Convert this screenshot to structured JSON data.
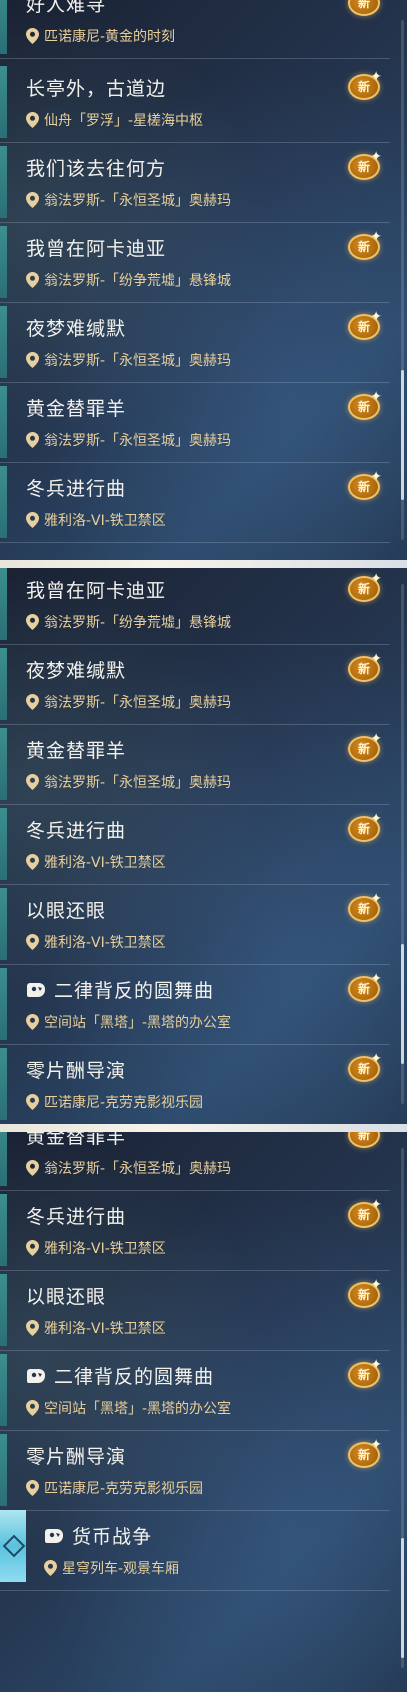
{
  "badge_text": "新",
  "colors": {
    "accent": "#3c8f8e",
    "title": "#f3f1ec",
    "location": "#e8cf9b",
    "badge": "#d48a1c"
  },
  "panel1": {
    "items": [
      {
        "title": "好人难寻",
        "location": "匹诺康尼-黄金的时刻"
      },
      {
        "title": "长亭外，古道边",
        "location": "仙舟「罗浮」-星槎海中枢"
      },
      {
        "title": "我们该去往何方",
        "location": "翁法罗斯-「永恒圣城」奥赫玛"
      },
      {
        "title": "我曾在阿卡迪亚",
        "location": "翁法罗斯-「纷争荒墟」悬锋城"
      },
      {
        "title": "夜梦难缄默",
        "location": "翁法罗斯-「永恒圣城」奥赫玛"
      },
      {
        "title": "黄金替罪羊",
        "location": "翁法罗斯-「永恒圣城」奥赫玛"
      },
      {
        "title": "冬兵进行曲",
        "location": "雅利洛-VI-铁卫禁区"
      }
    ]
  },
  "panel2": {
    "items": [
      {
        "title": "我曾在阿卡迪亚",
        "location": "翁法罗斯-「纷争荒墟」悬锋城"
      },
      {
        "title": "夜梦难缄默",
        "location": "翁法罗斯-「永恒圣城」奥赫玛"
      },
      {
        "title": "黄金替罪羊",
        "location": "翁法罗斯-「永恒圣城」奥赫玛"
      },
      {
        "title": "冬兵进行曲",
        "location": "雅利洛-VI-铁卫禁区"
      },
      {
        "title": "以眼还眼",
        "location": "雅利洛-VI-铁卫禁区"
      },
      {
        "title": "二律背反的圆舞曲",
        "location": "空间站「黑塔」-黑塔的办公室"
      },
      {
        "title": "零片酬导演",
        "location": "匹诺康尼-克劳克影视乐园"
      }
    ]
  },
  "panel3": {
    "items": [
      {
        "title": "黄金替罪羊",
        "location": "翁法罗斯-「永恒圣城」奥赫玛"
      },
      {
        "title": "冬兵进行曲",
        "location": "雅利洛-VI-铁卫禁区"
      },
      {
        "title": "以眼还眼",
        "location": "雅利洛-VI-铁卫禁区"
      },
      {
        "title": "二律背反的圆舞曲",
        "location": "空间站「黑塔」-黑塔的办公室"
      },
      {
        "title": "零片酬导演",
        "location": "匹诺康尼-克劳克影视乐园"
      },
      {
        "title": "货币战争",
        "location": "星穹列车-观景车厢"
      }
    ]
  }
}
